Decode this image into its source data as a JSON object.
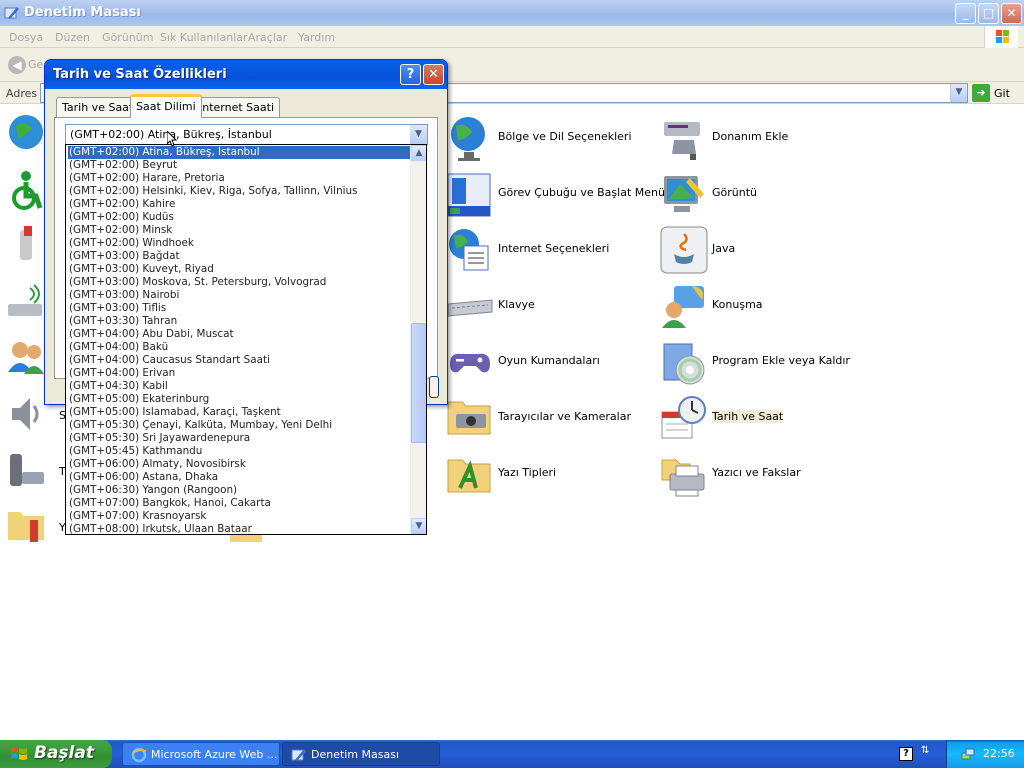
{
  "window": {
    "title": "Denetim Masası",
    "minimize": "_",
    "maximize": "□",
    "close": "✕"
  },
  "menu": [
    "Dosya",
    "Düzen",
    "Görünüm",
    "Sık Kullanılanlar",
    "Araçlar",
    "Yardım"
  ],
  "toolbar": {
    "back_label": "Ge"
  },
  "address": {
    "label": "Adres",
    "go_label": "Git"
  },
  "control_panel_items": [
    {
      "label": "Bölge ve Dil Seçenekleri",
      "icon": "globe-icon"
    },
    {
      "label": "Donanım Ekle",
      "icon": "hardware-icon"
    },
    {
      "label": "Görev Çubuğu ve Başlat Menüsü",
      "icon": "taskbar-icon"
    },
    {
      "label": "Görüntü",
      "icon": "display-icon"
    },
    {
      "label": "Internet Seçenekleri",
      "icon": "internet-options-icon"
    },
    {
      "label": "Java",
      "icon": "java-icon"
    },
    {
      "label": "Klavye",
      "icon": "keyboard-icon"
    },
    {
      "label": "Konuşma",
      "icon": "speech-icon"
    },
    {
      "label": "Oyun Kumandaları",
      "icon": "gamepad-icon"
    },
    {
      "label": "Program Ekle veya Kaldır",
      "icon": "add-remove-programs-icon"
    },
    {
      "label": "Tarayıcılar ve Kameralar",
      "icon": "scanner-camera-icon"
    },
    {
      "label": "Tarih ve Saat",
      "icon": "date-time-icon"
    },
    {
      "label": "Yazı Tipleri",
      "icon": "fonts-folder-icon"
    },
    {
      "label": "Yazıcı ve Fakslar",
      "icon": "printer-icon"
    }
  ],
  "left_labels": {
    "sounds": "S",
    "phone": "T",
    "tools": "Y"
  },
  "dialog": {
    "title": "Tarih ve Saat Özellikleri",
    "help": "?",
    "close": "✕",
    "tabs": [
      "Tarih ve Saat",
      "Saat Dilimi",
      "Internet Saati"
    ],
    "active_tab": "Saat Dilimi",
    "selected_timezone": "(GMT+02:00) Atina, Bükreş, İstanbul"
  },
  "timezones": [
    "(GMT+02:00) Atina, Bükreş, İstanbul",
    "(GMT+02:00) Beyrut",
    "(GMT+02:00) Harare, Pretoria",
    "(GMT+02:00) Helsinki, Kiev, Riga, Sofya, Tallinn, Vilnius",
    "(GMT+02:00) Kahire",
    "(GMT+02:00) Kudüs",
    "(GMT+02:00) Minsk",
    "(GMT+02:00) Windhoek",
    "(GMT+03:00) Bağdat",
    "(GMT+03:00) Kuveyt, Riyad",
    "(GMT+03:00) Moskova, St. Petersburg, Volvograd",
    "(GMT+03:00) Nairobi",
    "(GMT+03:00) Tiflis",
    "(GMT+03:30) Tahran",
    "(GMT+04:00) Abu Dabi, Muscat",
    "(GMT+04:00) Bakü",
    "(GMT+04:00) Caucasus Standart Saati",
    "(GMT+04:00) Erivan",
    "(GMT+04:30) Kabil",
    "(GMT+05:00) Ekaterinburg",
    "(GMT+05:00) Islamabad, Karaçi, Taşkent",
    "(GMT+05:30) Çenayi, Kalküta, Mumbay, Yeni Delhi",
    "(GMT+05:30) Sri Jayawardenepura",
    "(GMT+05:45) Kathmandu",
    "(GMT+06:00) Almaty, Novosibirsk",
    "(GMT+06:00) Astana, Dhaka",
    "(GMT+06:30) Yangon (Rangoon)",
    "(GMT+07:00) Bangkok, Hanoi, Cakarta",
    "(GMT+07:00) Krasnoyarsk",
    "(GMT+08:00) Irkutsk, Ulaan Bataar"
  ],
  "taskbar": {
    "start_label": "Başlat",
    "tasks": [
      "Microsoft Azure Web ...",
      "Denetim Masası"
    ],
    "help": "?",
    "clock": "22:56"
  },
  "colors": {
    "selection": "#316ac5",
    "dialog_title": "#0858e1",
    "taskbar": "#245ed8",
    "start_button": "#379b38"
  }
}
